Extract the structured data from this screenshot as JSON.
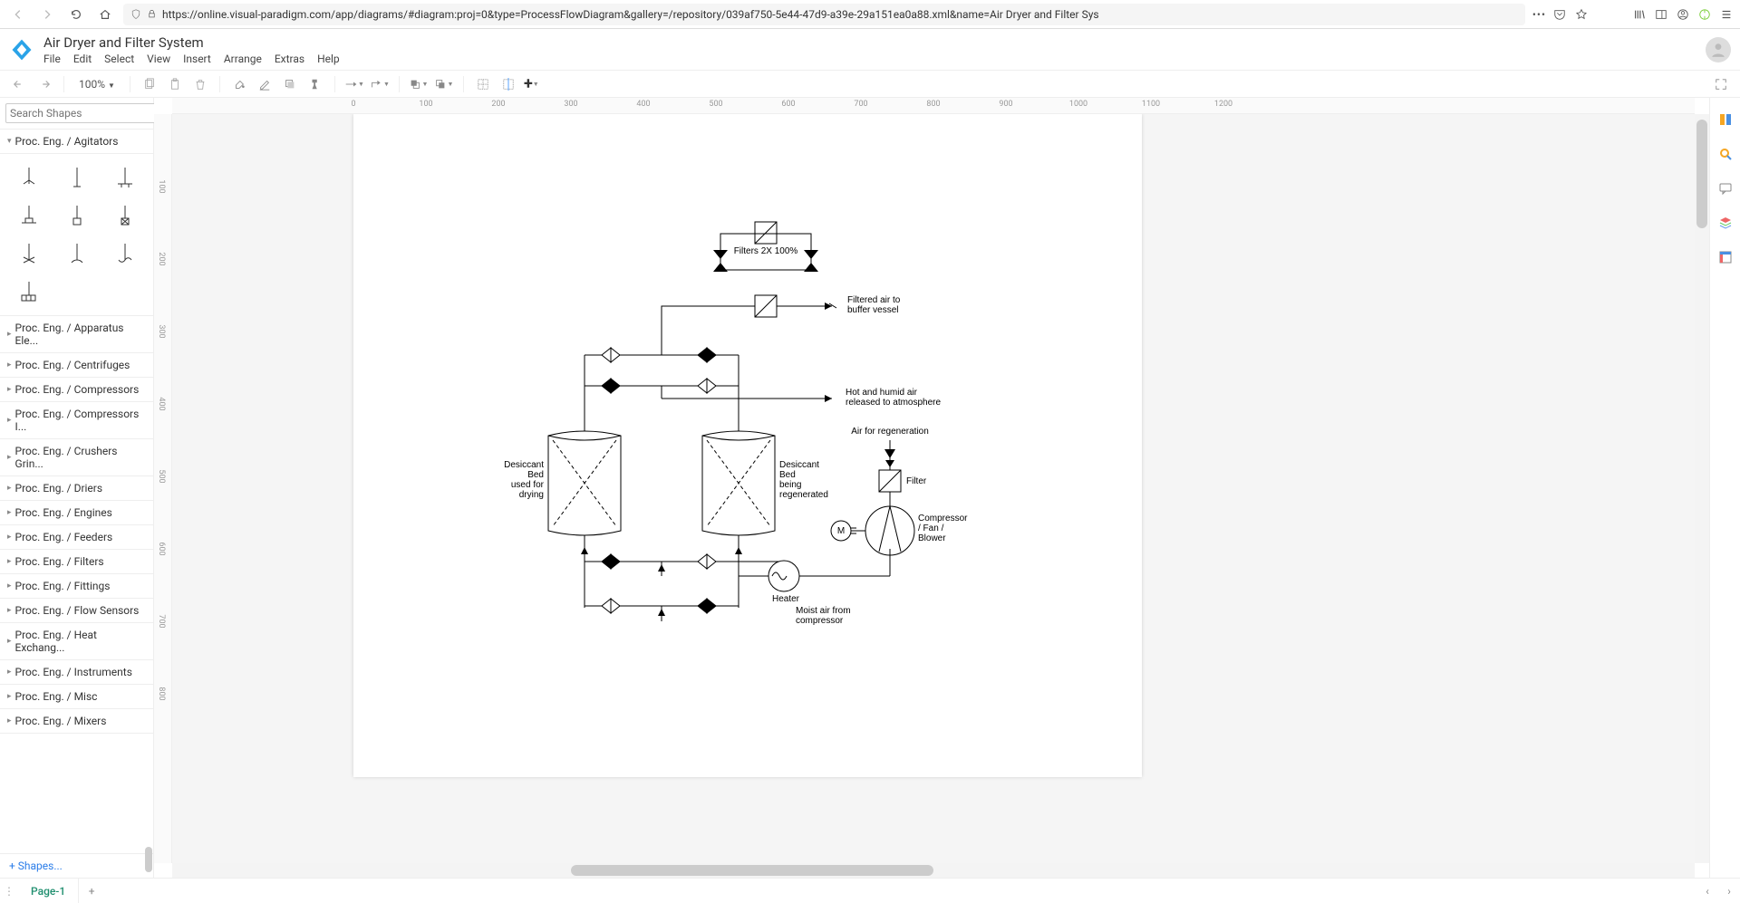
{
  "browser": {
    "url": "https://online.visual-paradigm.com/app/diagrams/#diagram:proj=0&type=ProcessFlowDiagram&gallery=/repository/039af750-5e44-47d9-a39e-29a151ea0a88.xml&name=Air Dryer and Filter Sys"
  },
  "app": {
    "title": "Air Dryer and Filter System",
    "menus": {
      "file": "File",
      "edit": "Edit",
      "select": "Select",
      "view": "View",
      "insert": "Insert",
      "arrange": "Arrange",
      "extras": "Extras",
      "help": "Help"
    }
  },
  "toolbar": {
    "zoom": "100%"
  },
  "sidebar": {
    "search_placeholder": "Search Shapes",
    "open_category": "Proc. Eng. / Agitators",
    "categories": [
      "Proc. Eng. / Apparatus Ele...",
      "Proc. Eng. / Centrifuges",
      "Proc. Eng. / Compressors",
      "Proc. Eng. / Compressors I...",
      "Proc. Eng. / Crushers Grin...",
      "Proc. Eng. / Driers",
      "Proc. Eng. / Engines",
      "Proc. Eng. / Feeders",
      "Proc. Eng. / Filters",
      "Proc. Eng. / Fittings",
      "Proc. Eng. / Flow Sensors",
      "Proc. Eng. / Heat Exchang...",
      "Proc. Eng. / Instruments",
      "Proc. Eng. / Misc",
      "Proc. Eng. / Mixers"
    ],
    "shapes_footer": "Shapes..."
  },
  "ruler": {
    "top_ticks": [
      "0",
      "100",
      "200",
      "300",
      "400",
      "500",
      "600",
      "700",
      "800",
      "900",
      "1000",
      "1100",
      "1200"
    ],
    "left_ticks": [
      "100",
      "200",
      "300",
      "400",
      "500",
      "600",
      "700",
      "800"
    ]
  },
  "diagram": {
    "labels": {
      "filters_top": "Filters 2X 100%",
      "filtered_air1": "Filtered air to",
      "filtered_air2": "buffer vessel",
      "hot_humid1": "Hot and humid air",
      "hot_humid2": "released to atmosphere",
      "air_regen": "Air for regeneration",
      "filter": "Filter",
      "compressor1": "Compressor",
      "compressor2": "/ Fan /",
      "compressor3": "Blower",
      "motor": "M",
      "heater": "Heater",
      "moist1": "Moist air from",
      "moist2": "compressor",
      "bed_left1": "Desiccant",
      "bed_left2": "Bed",
      "bed_left3": "used for",
      "bed_left4": "drying",
      "bed_right1": "Desiccant",
      "bed_right2": "Bed",
      "bed_right3": "being",
      "bed_right4": "regenerated"
    }
  },
  "tabs": {
    "page1": "Page-1"
  }
}
